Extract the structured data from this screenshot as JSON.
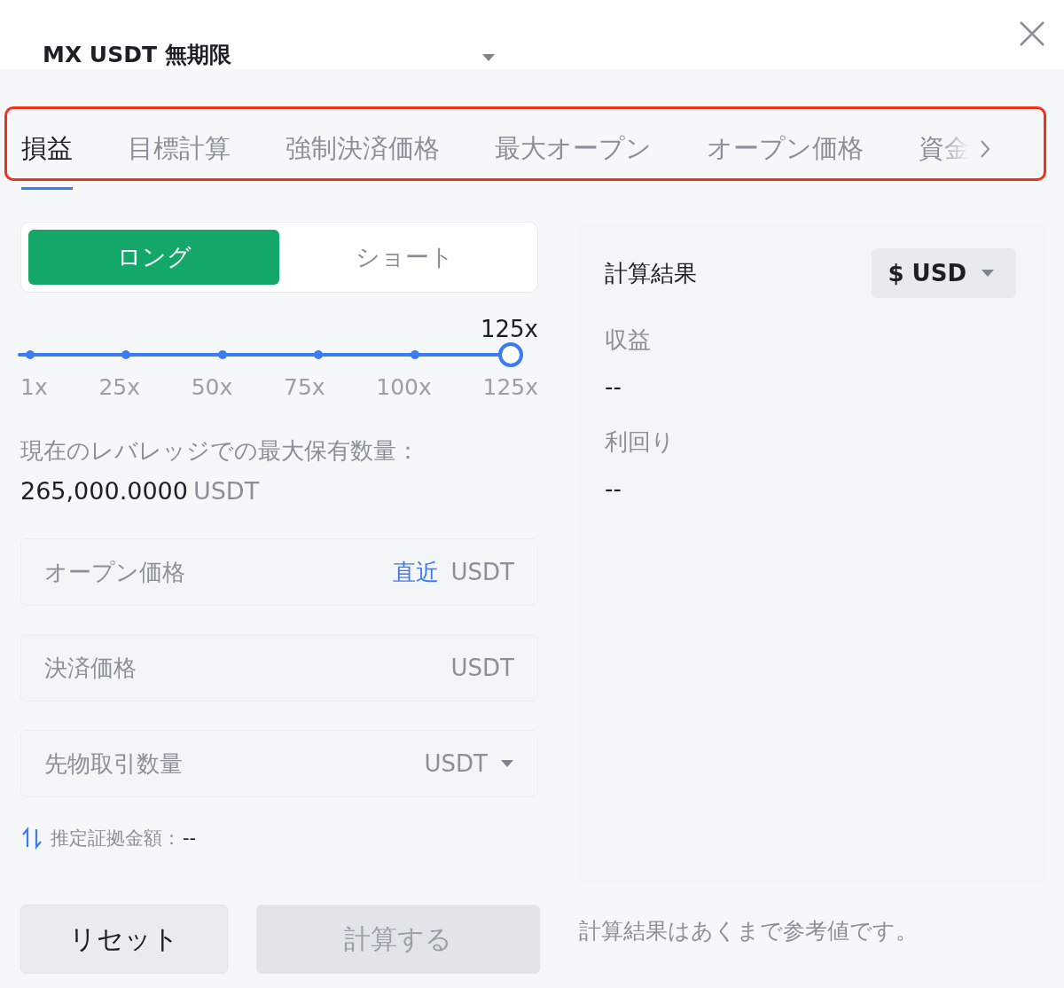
{
  "header": {
    "symbol": "MX USDT 無期限"
  },
  "tabs": [
    {
      "label": "損益",
      "selected": true
    },
    {
      "label": "目標計算",
      "selected": false
    },
    {
      "label": "強制決済価格",
      "selected": false
    },
    {
      "label": "最大オープン",
      "selected": false
    },
    {
      "label": "オープン価格",
      "selected": false
    },
    {
      "label": "資金",
      "selected": false
    }
  ],
  "side_toggle": [
    {
      "label": "ロング",
      "selected": true
    },
    {
      "label": "ショート",
      "selected": false
    }
  ],
  "leverage": {
    "reading": "125x",
    "level": 1,
    "marks": [
      "1x",
      "25x",
      "50x",
      "75x",
      "100x",
      "125x"
    ]
  },
  "max_position": {
    "label": "現在のレバレッジでの最大保有数量：",
    "value": "265,000.0000",
    "unit": "USDT"
  },
  "fields": [
    {
      "kind": "latest",
      "label": "オープン価格",
      "link": "直近",
      "unit": "USDT"
    },
    {
      "kind": "plain",
      "label": "決済価格",
      "unit": "USDT"
    },
    {
      "kind": "dropdown",
      "label": "先物取引数量",
      "unit": "USDT"
    }
  ],
  "margin": {
    "label": "推定証拠金額：",
    "value": "--"
  },
  "buttons": [
    {
      "label": "リセット",
      "disabled": false
    },
    {
      "label": "計算する",
      "disabled": true
    }
  ],
  "result": {
    "title": "計算結果",
    "currency": "$ USD",
    "items": [
      {
        "label": "収益",
        "value": "--"
      },
      {
        "label": "利回り",
        "value": "--"
      }
    ]
  },
  "note": "計算結果はあくまで参考値です。"
}
